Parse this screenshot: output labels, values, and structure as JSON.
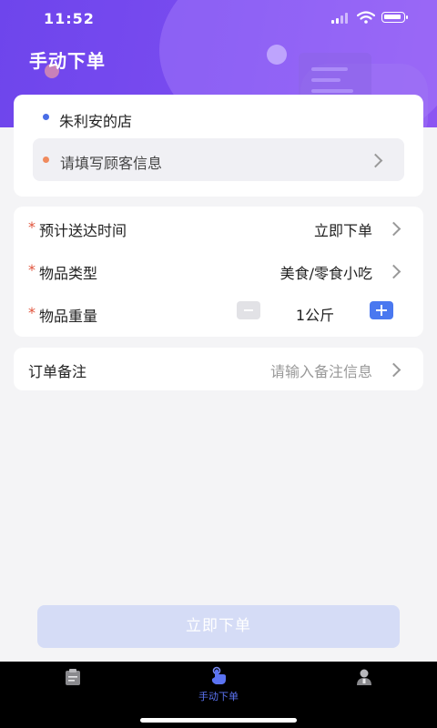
{
  "status": {
    "time": "11:52"
  },
  "header": {
    "title": "手动下单"
  },
  "store": {
    "name": "朱利安的店"
  },
  "customer": {
    "placeholder": "请填写顾客信息"
  },
  "form": {
    "delivery_time": {
      "label": "预计送达时间",
      "value": "立即下单",
      "required": "*"
    },
    "item_type": {
      "label": "物品类型",
      "value": "美食/零食小吃",
      "required": "*"
    },
    "item_weight": {
      "label": "物品重量",
      "value": "1公斤",
      "required": "*"
    }
  },
  "remark": {
    "label": "订单备注",
    "placeholder": "请输入备注信息"
  },
  "submit": {
    "label": "立即下单"
  },
  "tabbar": {
    "items": [
      {
        "icon": "clipboard-icon",
        "label": ""
      },
      {
        "icon": "hand-tap-icon",
        "label": "手动下单",
        "active": true
      },
      {
        "icon": "user-icon",
        "label": ""
      }
    ],
    "active_color": "#5b73f2"
  },
  "colors": {
    "header": "#7b4cf0",
    "required": "#e0533b",
    "plus": "#4a78f0",
    "submit_disabled": "#d5dcf6"
  }
}
